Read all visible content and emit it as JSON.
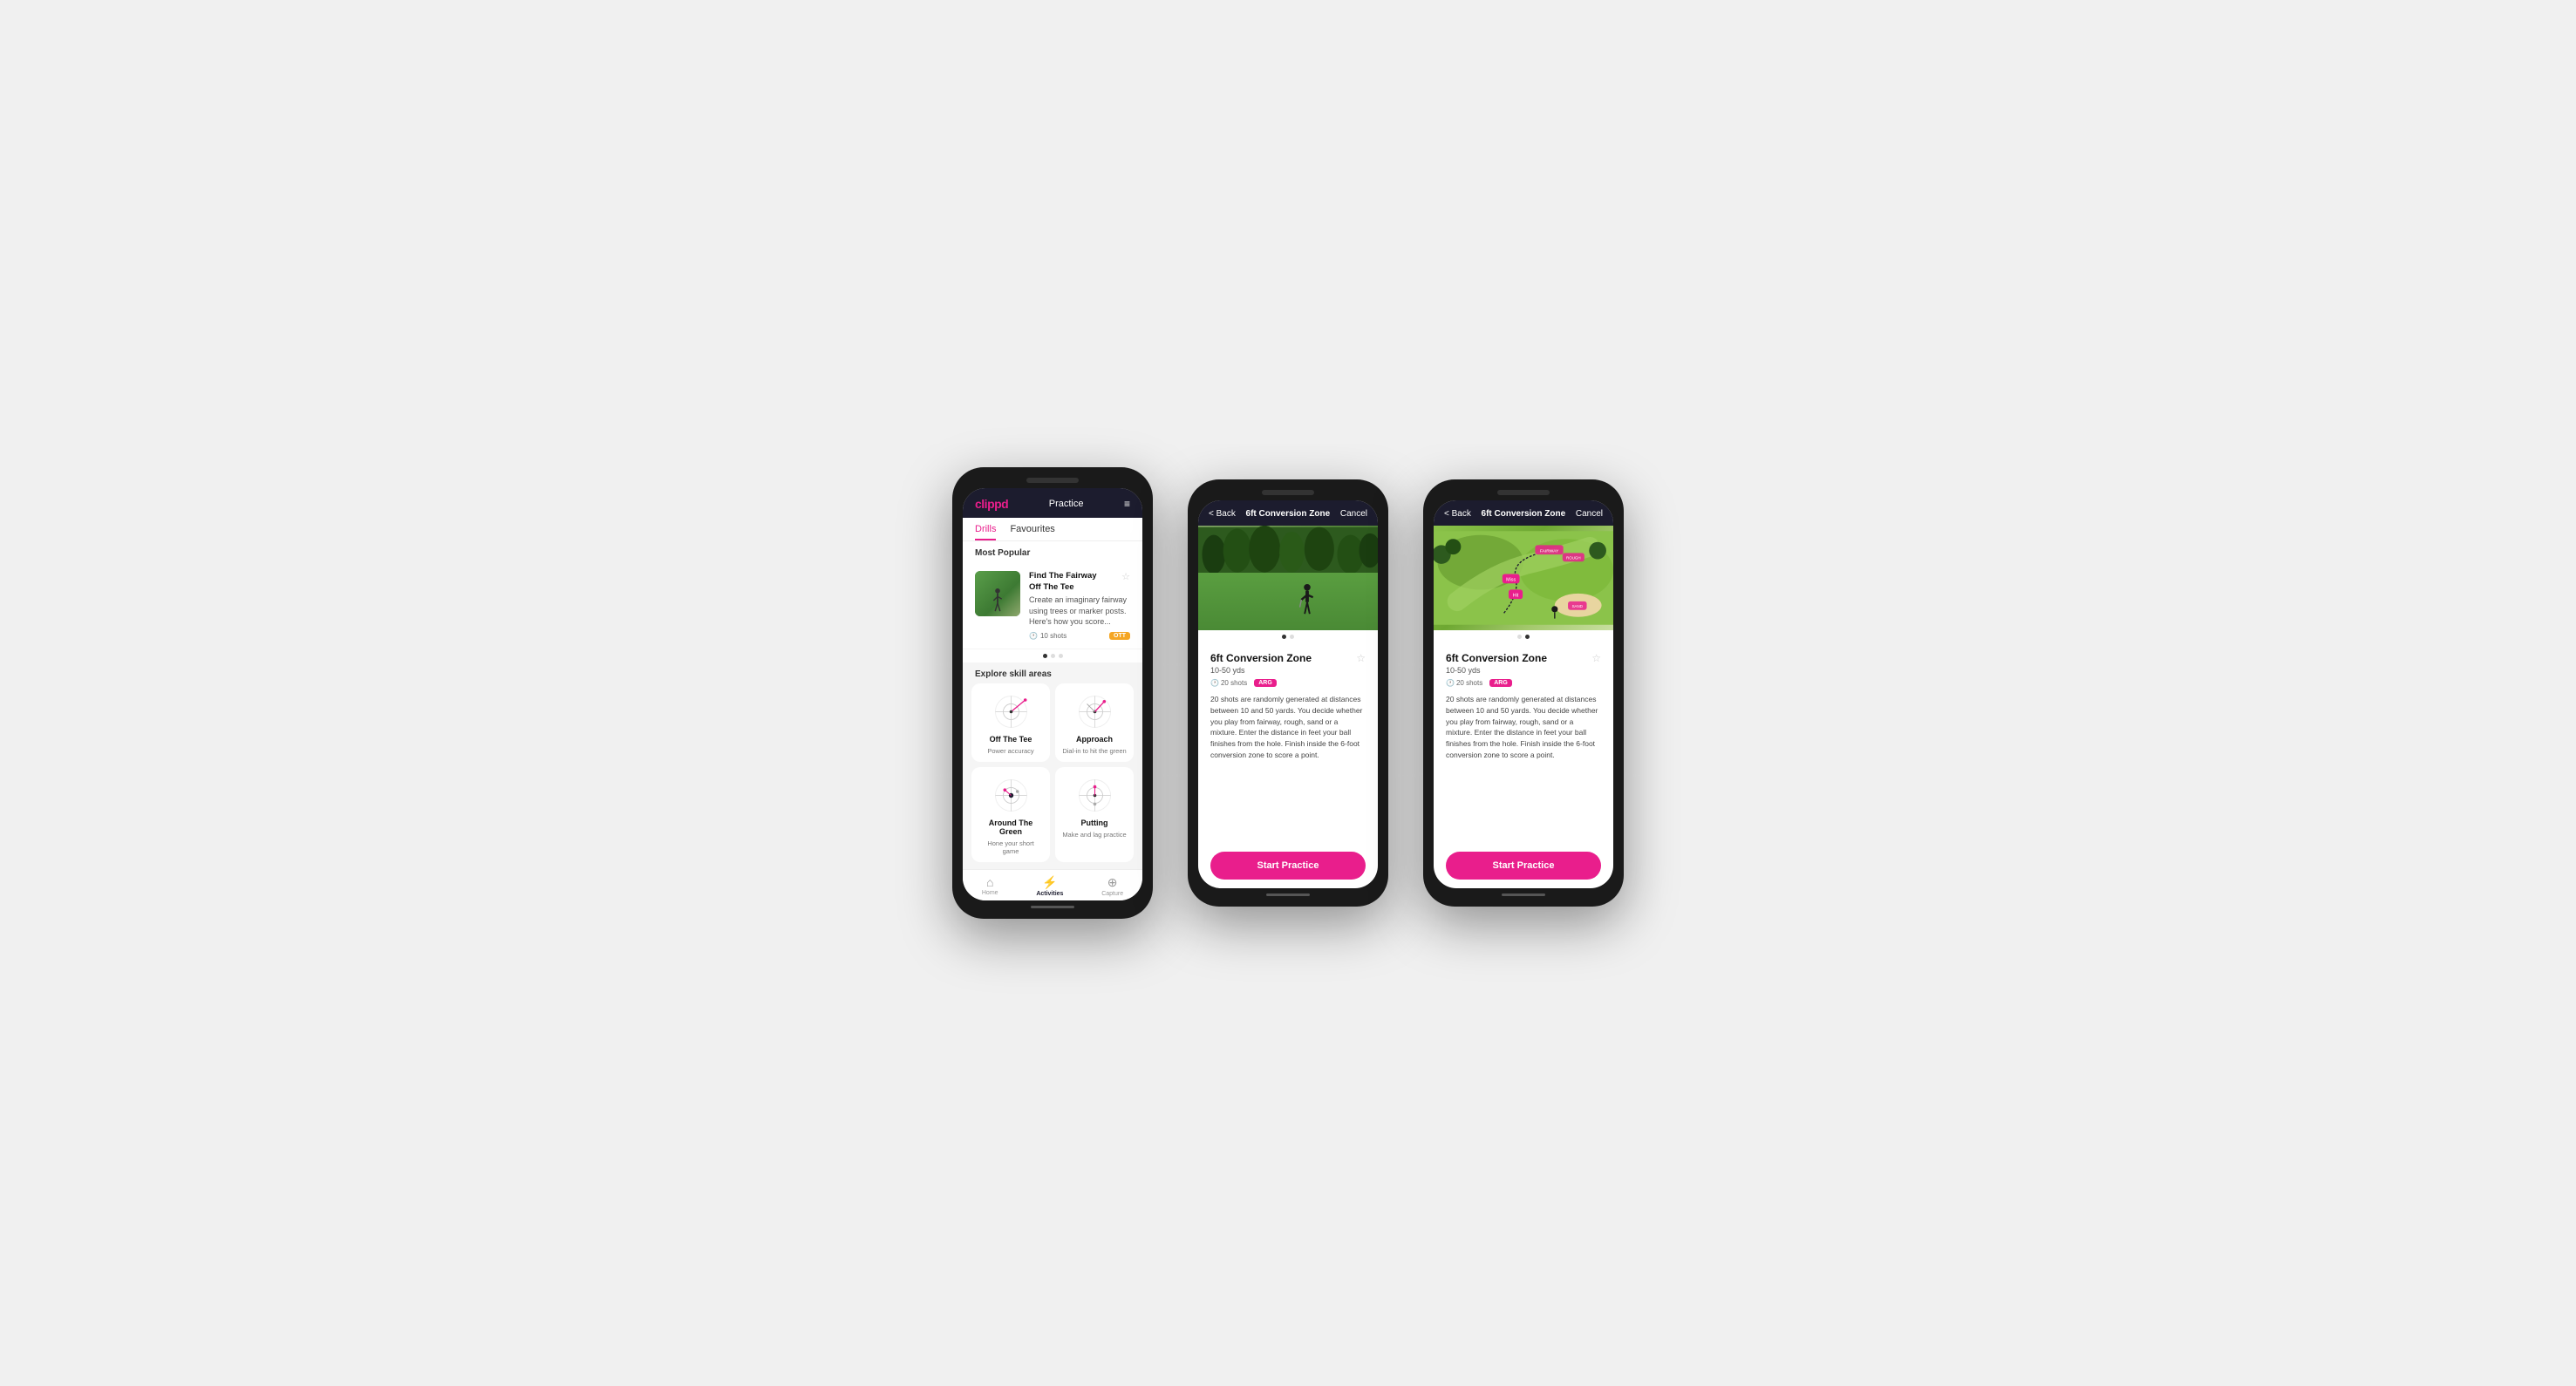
{
  "app": {
    "name": "clippd",
    "header_title": "Practice",
    "menu_icon": "≡"
  },
  "phone1": {
    "tabs": [
      {
        "label": "Drills",
        "active": true
      },
      {
        "label": "Favourites",
        "active": false
      }
    ],
    "most_popular_label": "Most Popular",
    "explore_label": "Explore skill areas",
    "featured_drill": {
      "title": "Find The Fairway",
      "subtitle": "Off The Tee",
      "description": "Create an imaginary fairway using trees or marker posts. Here's how you score...",
      "shots": "10 shots",
      "badge": "OTT"
    },
    "skill_areas": [
      {
        "name": "Off The Tee",
        "desc": "Power accuracy"
      },
      {
        "name": "Approach",
        "desc": "Dial-in to hit the green"
      },
      {
        "name": "Around The Green",
        "desc": "Hone your short game"
      },
      {
        "name": "Putting",
        "desc": "Make and lag practice"
      }
    ],
    "nav": [
      {
        "label": "Home",
        "icon": "🏠",
        "active": false
      },
      {
        "label": "Activities",
        "icon": "⚡",
        "active": true
      },
      {
        "label": "Capture",
        "icon": "➕",
        "active": false
      }
    ]
  },
  "phone2": {
    "back_label": "< Back",
    "title": "6ft Conversion Zone",
    "cancel_label": "Cancel",
    "drill_title": "6ft Conversion Zone",
    "drill_range": "10-50 yds",
    "shots": "20 shots",
    "badge": "ARG",
    "description": "20 shots are randomly generated at distances between 10 and 50 yards. You decide whether you play from fairway, rough, sand or a mixture. Enter the distance in feet your ball finishes from the hole. Finish inside the 6-foot conversion zone to score a point.",
    "start_label": "Start Practice"
  },
  "phone3": {
    "back_label": "< Back",
    "title": "6ft Conversion Zone",
    "cancel_label": "Cancel",
    "drill_title": "6ft Conversion Zone",
    "drill_range": "10-50 yds",
    "shots": "20 shots",
    "badge": "ARG",
    "description": "20 shots are randomly generated at distances between 10 and 50 yards. You decide whether you play from fairway, rough, sand or a mixture. Enter the distance in feet your ball finishes from the hole. Finish inside the 6-foot conversion zone to score a point.",
    "start_label": "Start Practice",
    "map_labels": [
      "FAIRWAY",
      "ROUGH",
      "SAND",
      "Miss",
      "Hit"
    ]
  },
  "colors": {
    "brand_pink": "#e91e8c",
    "dark_nav": "#1c1c2e",
    "badge_orange": "#f5a623"
  }
}
